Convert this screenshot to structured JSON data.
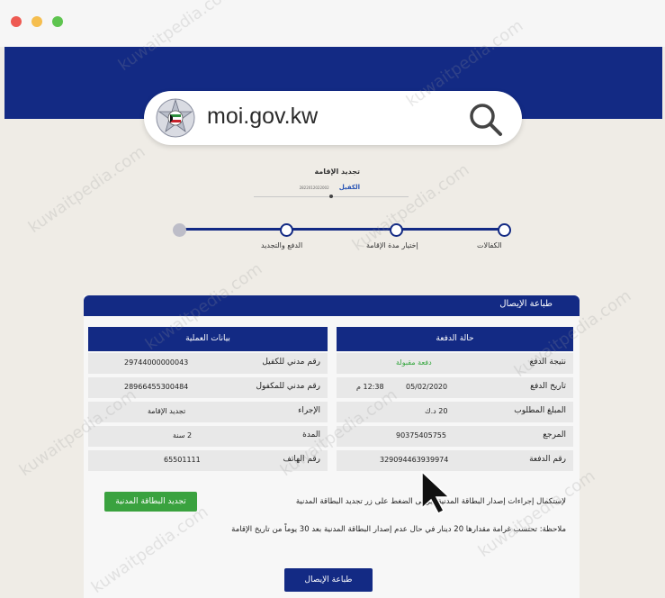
{
  "browser": {
    "url": "moi.gov.kw"
  },
  "renewal": {
    "title": "تجديد الإقامة",
    "sponsor_label": "الكفيل",
    "sponsor_value": "2822012022002"
  },
  "steps": [
    {
      "label": "الكفالات"
    },
    {
      "label": "إختيار مدة الإقامة"
    },
    {
      "label": "الدفع والتجديد"
    },
    {
      "label": ""
    }
  ],
  "receipt": {
    "title": "طباعة الإيصال",
    "payment_status": {
      "title": "حالة الدفعة",
      "rows": [
        {
          "label": "نتيجة الدفع",
          "value": "دفعة مقبولة"
        },
        {
          "label": "تاريخ الدفع",
          "value": "05/02/2020",
          "time": "12:38 م"
        },
        {
          "label": "المبلغ المطلوب",
          "value": "20 د.ك"
        },
        {
          "label": "المرجع",
          "value": "90375405755"
        },
        {
          "label": "رقم الدفعة",
          "value": "329094463939974"
        }
      ]
    },
    "transaction": {
      "title": "بيانات العملية",
      "rows": [
        {
          "label": "رقم مدني للكفيل",
          "value": "29744000000043"
        },
        {
          "label": "رقم مدني للمكفول",
          "value": "28966455300484"
        },
        {
          "label": "الإجراء",
          "value": "تجديد الإقامة"
        },
        {
          "label": "المدة",
          "value": "2 سنة"
        },
        {
          "label": "رقم الهاتف",
          "value": "65501111"
        }
      ]
    },
    "notice": "لإستكمال إجراءات إصدار البطاقة المدنية، يرجى الضغط على زر تجديد البطاقة المدنية",
    "note": "ملاحظة: تحتسب غرامة مقدارها 20 دينار في حال عدم إصدار البطاقة المدنية بعد 30 يوماً من تاريخ الإقامة",
    "renew_card_button": "تجديد البطاقة المدنية",
    "print_button": "طباعة الإيصال"
  },
  "watermark": "kuwaitpedia.com",
  "colors": {
    "primary": "#132a84",
    "success": "#3aa23f",
    "background": "#efece6"
  }
}
